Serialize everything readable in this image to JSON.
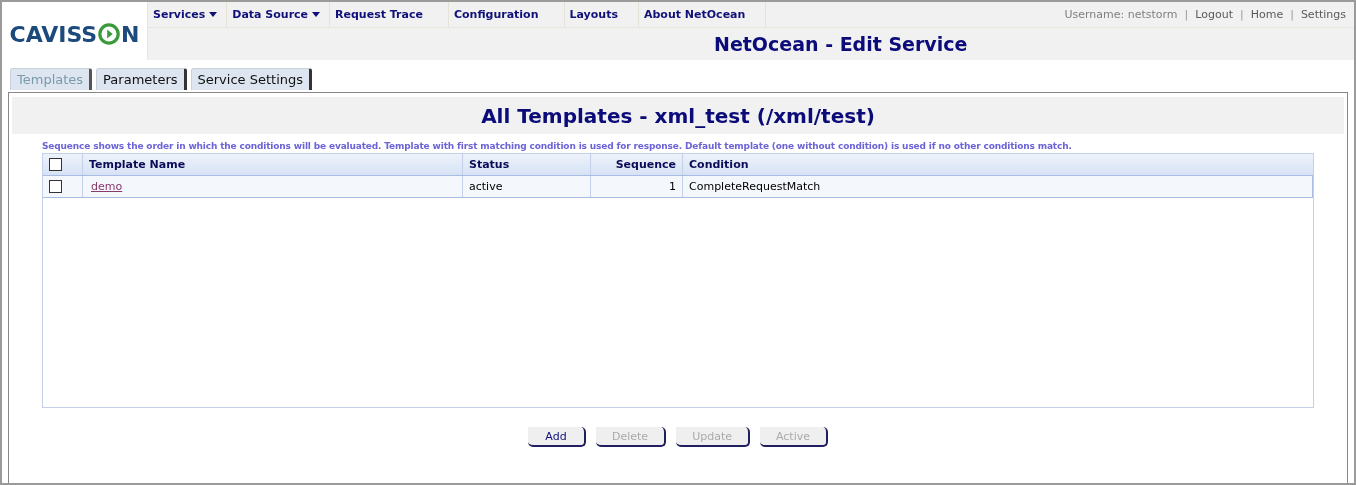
{
  "logo": {
    "before": "CAVISS",
    "after": "N"
  },
  "nav": [
    {
      "label": "Services",
      "dropdown": true
    },
    {
      "label": "Data Source",
      "dropdown": true
    },
    {
      "label": "Request Trace",
      "dropdown": false
    },
    {
      "label": "Configuration",
      "dropdown": false
    },
    {
      "label": "Layouts",
      "dropdown": false
    },
    {
      "label": "About NetOcean",
      "dropdown": false
    }
  ],
  "user_links": [
    {
      "kind": "text",
      "text": "Username: netstorm"
    },
    {
      "kind": "separator",
      "text": "|"
    },
    {
      "kind": "link",
      "text": "Logout"
    },
    {
      "kind": "separator",
      "text": "|"
    },
    {
      "kind": "link",
      "text": "Home"
    },
    {
      "kind": "separator",
      "text": "|"
    },
    {
      "kind": "link",
      "text": "Settings"
    }
  ],
  "page_title": "NetOcean - Edit Service",
  "tabs": [
    {
      "label": "Templates",
      "selected": true
    },
    {
      "label": "Parameters",
      "selected": false
    },
    {
      "label": "Service Settings",
      "selected": false
    }
  ],
  "heading": "All Templates - xml_test (/xml/test)",
  "description": "Sequence shows the order in which the conditions will be evaluated. Template with first matching condition is used for response. Default template (one without condition) is used if no other conditions match.",
  "table": {
    "select_all_checked": false,
    "columns": [
      "Template Name",
      "Status",
      "Sequence",
      "Condition"
    ],
    "rows": [
      {
        "checked": false,
        "name": "demo",
        "status": "active",
        "sequence": "1",
        "condition": "CompleteRequestMatch"
      }
    ]
  },
  "buttons": [
    {
      "label": "Add",
      "disabled": false
    },
    {
      "label": "Delete",
      "disabled": true
    },
    {
      "label": "Update",
      "disabled": true
    },
    {
      "label": "Active",
      "disabled": true
    }
  ]
}
